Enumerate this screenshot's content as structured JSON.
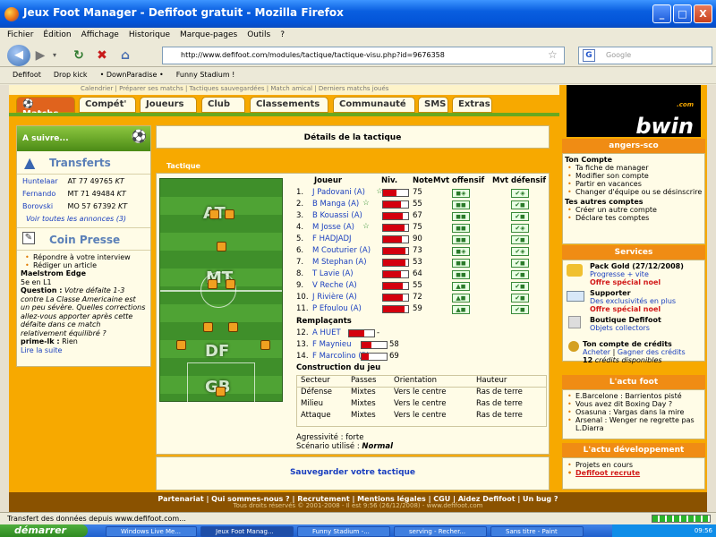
{
  "window": {
    "title": "Jeux Foot Manager - Defifoot gratuit - Mozilla Firefox",
    "min": "_",
    "max": "□",
    "close": "X"
  },
  "menu": [
    "Fichier",
    "Édition",
    "Affichage",
    "Historique",
    "Marque-pages",
    "Outils",
    "?"
  ],
  "nav": {
    "url": "http://www.defifoot.com/modules/tactique/tactique-visu.php?id=9676358",
    "search_placeholder": "Google",
    "star": "☆"
  },
  "bookmarks": [
    "Defifoot",
    "Drop kick",
    "• DownParadise •",
    "Funny Stadium !"
  ],
  "site": {
    "top_strip": "Calendrier | Préparer ses matchs | Tactiques sauvegardées | Match amical | Derniers matchs joués",
    "tabs": [
      "Matchs",
      "Compét'",
      "Joueurs",
      "Club",
      "Classements",
      "Communauté",
      "SMS",
      "Extras"
    ],
    "left": {
      "a_suivre": "A suivre...",
      "transferts_title": "Transferts",
      "transfers": [
        {
          "name": "Huntelaar",
          "pos": "AT",
          "lvl": "77",
          "price": "49765",
          "cur": "KT"
        },
        {
          "name": "Fernando",
          "pos": "MT",
          "lvl": "71",
          "price": "49484",
          "cur": "KT"
        },
        {
          "name": "Borovski",
          "pos": "MO",
          "lvl": "57",
          "price": "67392",
          "cur": "KT"
        }
      ],
      "all_ads": "Voir toutes les annonces (3)",
      "presse_title": "Coin Presse",
      "presse_items": [
        "Répondre à votre interview",
        "Rédiger un article"
      ],
      "team": "Maelstrom Edge",
      "league": "5e en L1",
      "question_label": "Question :",
      "question": "Votre défaite 1-3 contre La Classe Americaine est un peu sévère. Quelles corrections allez-vous apporter après cette défaite dans ce match relativement équilibré ?",
      "answerer": "prime-lk :",
      "answer": "Rien",
      "read_more": "Lire la suite"
    },
    "center": {
      "details_title": "Détails de la tactique",
      "tab_label": "Tactique",
      "headers": {
        "joueur": "Joueur",
        "niv": "Niv.",
        "note": "Note",
        "mvt_off": "Mvt offensif",
        "mvt_def": "Mvt défensif"
      },
      "players": [
        {
          "num": "1.",
          "name": "J Padovani (A)",
          "star": true,
          "note": "75",
          "fill": 0.55,
          "off": "◼◈",
          "def": "✔◈"
        },
        {
          "num": "2.",
          "name": "B Manga (A)",
          "star": true,
          "note": "55",
          "fill": 0.7,
          "off": "◼◼",
          "def": "✔◼"
        },
        {
          "num": "3.",
          "name": "B Kouassi (A)",
          "star": false,
          "note": "67",
          "fill": 0.8,
          "off": "◼◼",
          "def": "✔◼"
        },
        {
          "num": "4.",
          "name": "M Josse (A)",
          "star": true,
          "note": "75",
          "fill": 0.85,
          "off": "◼◼",
          "def": "✔◈"
        },
        {
          "num": "5.",
          "name": "F HADJADJ",
          "star": false,
          "note": "90",
          "fill": 0.75,
          "off": "◼◼",
          "def": "✔◼"
        },
        {
          "num": "6.",
          "name": "M Couturier (A)",
          "star": false,
          "note": "73",
          "fill": 0.9,
          "off": "◼◈",
          "def": "✔◈"
        },
        {
          "num": "7.",
          "name": "M Stephan (A)",
          "star": false,
          "note": "53",
          "fill": 0.9,
          "off": "◼◼",
          "def": "✔◼"
        },
        {
          "num": "8.",
          "name": "T Lavie (A)",
          "star": false,
          "note": "64",
          "fill": 0.7,
          "off": "◼◼",
          "def": "✔◼"
        },
        {
          "num": "9.",
          "name": "V Reche (A)",
          "star": false,
          "note": "55",
          "fill": 0.8,
          "off": "▲◼",
          "def": "✔◼"
        },
        {
          "num": "10.",
          "name": "J Rivière (A)",
          "star": false,
          "note": "72",
          "fill": 0.8,
          "off": "▲◼",
          "def": "✔◼"
        },
        {
          "num": "11.",
          "name": "P Efoulou (A)",
          "star": false,
          "note": "59",
          "fill": 0.85,
          "off": "▲◼",
          "def": "✔◼"
        }
      ],
      "remplacants_title": "Remplaçants",
      "subs": [
        {
          "num": "12.",
          "name": "A HUET",
          "note": "-",
          "fill": 0.6
        },
        {
          "num": "13.",
          "name": "F Maynieu",
          "note": "58",
          "fill": 0.4
        },
        {
          "num": "14.",
          "name": "F Marcolino (B)",
          "note": "69",
          "fill": 0.3
        }
      ],
      "construction_title": "Construction du jeu",
      "construction_headers": [
        "Secteur",
        "Passes",
        "Orientation",
        "Hauteur"
      ],
      "construction_rows": [
        [
          "Défense",
          "Mixtes",
          "Vers le centre",
          "Ras de terre"
        ],
        [
          "Milieu",
          "Mixtes",
          "Vers le centre",
          "Ras de terre"
        ],
        [
          "Attaque",
          "Mixtes",
          "Vers le centre",
          "Ras de terre"
        ]
      ],
      "agressivite": "Agressivité : forte",
      "scenario_label": "Scénario utilisé :",
      "scenario": "Normal",
      "zones": [
        "AT",
        "MT",
        "DF",
        "GB"
      ],
      "save": "Sauvegarder votre tactique"
    },
    "right": {
      "sponsor": "bwin",
      "sponsor_com": ".com",
      "user": "angers-sco",
      "ton_compte": "Ton Compte",
      "compte_items": [
        "Ta fiche de manager",
        "Modifier son compte",
        "Partir en vacances",
        "Changer d'équipe ou se désinscrire"
      ],
      "autres_title": "Tes autres comptes",
      "autres_items": [
        "Créer un autre compte",
        "Déclare tes comptes"
      ],
      "services_title": "Services",
      "pack_gold": "Pack Gold (27/12/2008)",
      "pack_sub": "Progresse + vite",
      "offre": "Offre spécial noel",
      "supporter": "Supporter",
      "supporter_sub": "Des exclusivités en plus",
      "boutique": "Boutique Defifoot",
      "boutique_sub": "Objets collectors",
      "credits_title": "Ton compte de crédits",
      "acheter": "Acheter",
      "gagner": "Gagner des crédits",
      "credits": "12",
      "credits_label": "crédits disponibles",
      "actu_foot_title": "L'actu foot",
      "actu_foot": [
        "E.Barcelone : Barrientos pisté",
        "Vous avez dit Boxing Day ?",
        "Osasuna : Vargas dans la mire",
        "Arsenal : Wenger ne regrette pas L.Diarra"
      ],
      "actu_dev_title": "L'actu développement",
      "actu_dev": [
        "Projets en cours",
        "Defifoot recrute"
      ]
    },
    "footer": "Partenariat | Qui sommes-nous ? | Recrutement | Mentions légales | CGU | Aidez Defifoot | Un bug ?",
    "footer2": "Tous droits réservés © 2001-2008 - Il est 9:56 (26/12/2008) - www.defifoot.com"
  },
  "status": "Transfert des données depuis www.defifoot.com...",
  "taskbar": {
    "start": "démarrer",
    "tasks": [
      "Windows Live Me...",
      "Jeux Foot Manag...",
      "Funny Stadium -...",
      "serving - Recher...",
      "Sans titre - Paint"
    ],
    "clock": "09:56"
  }
}
